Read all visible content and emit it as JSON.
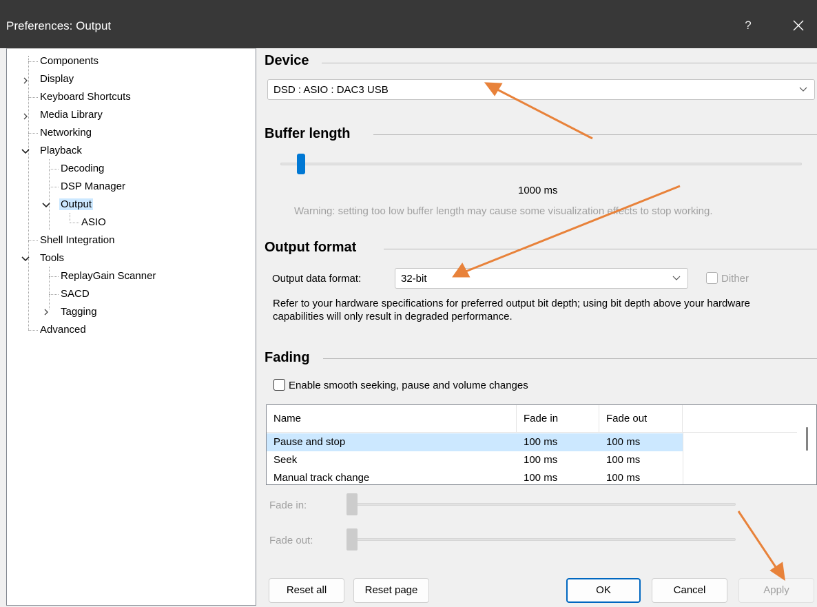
{
  "window": {
    "title": "Preferences: Output",
    "help_label": "?",
    "close_icon": "close-icon"
  },
  "tree": {
    "items": [
      {
        "label": "Components"
      },
      {
        "label": "Display"
      },
      {
        "label": "Keyboard Shortcuts"
      },
      {
        "label": "Media Library"
      },
      {
        "label": "Networking"
      },
      {
        "label": "Playback"
      },
      {
        "label": "Decoding"
      },
      {
        "label": "DSP Manager"
      },
      {
        "label": "Output"
      },
      {
        "label": "ASIO"
      },
      {
        "label": "Shell Integration"
      },
      {
        "label": "Tools"
      },
      {
        "label": "ReplayGain Scanner"
      },
      {
        "label": "SACD"
      },
      {
        "label": "Tagging"
      },
      {
        "label": "Advanced"
      }
    ]
  },
  "device": {
    "heading": "Device",
    "selected": "DSD : ASIO : DAC3 USB"
  },
  "buffer": {
    "heading": "Buffer length",
    "value_label": "1000 ms",
    "warning": "Warning: setting too low buffer length may cause some visualization effects to stop working."
  },
  "output_format": {
    "heading": "Output format",
    "label": "Output data format:",
    "selected": "32-bit",
    "dither_label": "Dither",
    "note": "Refer to your hardware specifications for preferred output bit depth; using bit depth above your hardware capabilities will only result in degraded performance."
  },
  "fading": {
    "heading": "Fading",
    "enable_label": "Enable smooth seeking, pause and volume changes",
    "columns": [
      "Name",
      "Fade in",
      "Fade out"
    ],
    "rows": [
      {
        "name": "Pause and stop",
        "fade_in": "100 ms",
        "fade_out": "100 ms"
      },
      {
        "name": "Seek",
        "fade_in": "100 ms",
        "fade_out": "100 ms"
      },
      {
        "name": "Manual track change",
        "fade_in": "100 ms",
        "fade_out": "100 ms"
      }
    ],
    "fade_in_label": "Fade in:",
    "fade_out_label": "Fade out:"
  },
  "buttons": {
    "reset_all": "Reset all",
    "reset_page": "Reset page",
    "ok": "OK",
    "cancel": "Cancel",
    "apply": "Apply"
  },
  "colors": {
    "titlebar": "#383838",
    "accent": "#0078d4",
    "selection": "#cce8ff",
    "annotation_arrow": "#e8823a"
  }
}
